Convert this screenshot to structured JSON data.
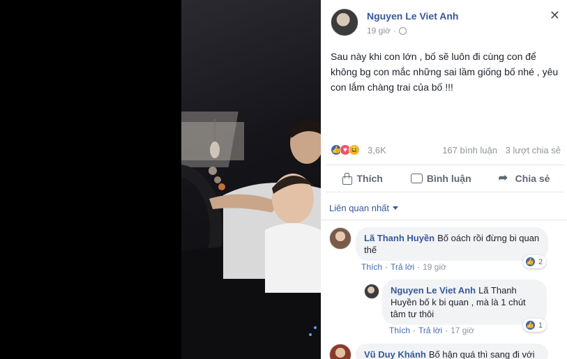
{
  "post": {
    "author": "Nguyen Le Viet Anh",
    "time": "19 giờ",
    "text": "Sau này khi con lớn , bố sẽ luôn đi cùng con để không bg con mắc những sai lầm giống bố nhé , yêu con lắm chàng trai của bố !!!"
  },
  "stats": {
    "reactions": "3,6K",
    "comments": "167 bình luận",
    "shares": "3 lượt chia sẻ"
  },
  "actions": {
    "like": "Thích",
    "comment": "Bình luận",
    "share": "Chia sẻ"
  },
  "sort": "Liên quan nhất",
  "comments": [
    {
      "name": "Lã Thanh Huyền",
      "text": "Bố oách rồi đừng bi quan thế",
      "like": "Thích",
      "reply": "Trả lời",
      "time": "19 giờ",
      "likes": "2"
    },
    {
      "name": "Nguyen Le Viet Anh",
      "text": "Lã Thanh Huyền bố k bi quan , mà là 1 chút tâm tư thôi",
      "like": "Thích",
      "reply": "Trả lời",
      "time": "17 giờ",
      "likes": "1"
    },
    {
      "name": "Vũ Duy Khánh",
      "text": "Bố hận quá thì sang đi với"
    }
  ],
  "colors": {
    "link": "#365899",
    "like": "#4267b2",
    "love": "#f25268",
    "haha": "#f7b125"
  }
}
